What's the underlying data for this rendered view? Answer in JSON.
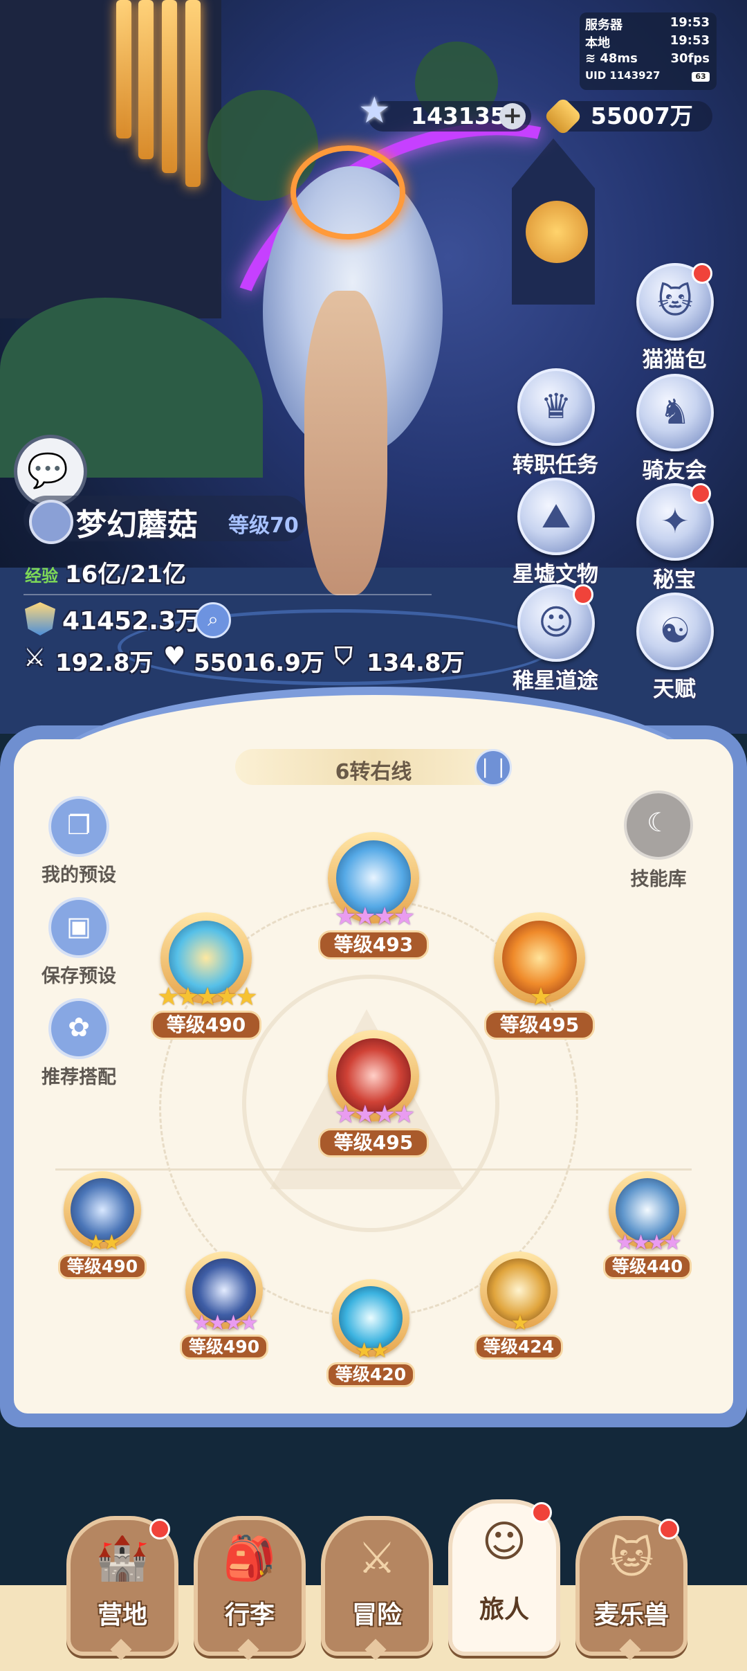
{
  "status": {
    "server_label": "服务器",
    "server_time": "19:53",
    "local_label": "本地",
    "local_time": "19:53",
    "ping": "48ms",
    "fps": "30fps",
    "uid": "UID 1143927",
    "battery": "63"
  },
  "currency": {
    "stars": "143135",
    "plus": "+",
    "coins": "55007万"
  },
  "right_menu": [
    {
      "label": "猫猫包",
      "icon": "cat-bag-icon",
      "badge": true
    },
    {
      "label": "转职任务",
      "icon": "job-change-icon",
      "badge": false
    },
    {
      "label": "骑友会",
      "icon": "horse-icon",
      "badge": false
    },
    {
      "label": "星墟文物",
      "icon": "relic-icon",
      "badge": false
    },
    {
      "label": "秘宝",
      "icon": "treasure-icon",
      "badge": true
    },
    {
      "label": "稚星道途",
      "icon": "star-path-icon",
      "badge": true
    },
    {
      "label": "天赋",
      "icon": "talent-icon",
      "badge": false
    }
  ],
  "player": {
    "name": "梦幻蘑菇",
    "level": "等级70",
    "exp_label": "经验",
    "exp": "16亿/21亿",
    "power": "41452.3万",
    "attack": "192.8万",
    "hp": "55016.9万",
    "defense": "134.8万"
  },
  "panel": {
    "title": "6转右线",
    "side_buttons": [
      "我的预设",
      "保存预设",
      "推荐搭配"
    ],
    "skill_library": "技能库",
    "skills": [
      {
        "level": "等级493",
        "stars": 4,
        "star_color": "pink"
      },
      {
        "level": "等级490",
        "stars": 5,
        "star_color": "gold"
      },
      {
        "level": "等级495",
        "stars": 1,
        "star_color": "gold"
      },
      {
        "level": "等级495",
        "stars": 4,
        "star_color": "pink"
      },
      {
        "level": "等级490",
        "stars": 2,
        "star_color": "gold"
      },
      {
        "level": "等级490",
        "stars": 4,
        "star_color": "pink"
      },
      {
        "level": "等级420",
        "stars": 2,
        "star_color": "gold"
      },
      {
        "level": "等级424",
        "stars": 1,
        "star_color": "gold"
      },
      {
        "level": "等级440",
        "stars": 4,
        "star_color": "pink"
      }
    ]
  },
  "bottom_nav": [
    {
      "label": "营地",
      "badge": true,
      "active": false
    },
    {
      "label": "行李",
      "badge": false,
      "active": false
    },
    {
      "label": "冒险",
      "badge": false,
      "active": false
    },
    {
      "label": "旅人",
      "badge": true,
      "active": true
    },
    {
      "label": "麦乐兽",
      "badge": true,
      "active": false
    }
  ],
  "colors": {
    "panel_bg": "#fbf5e8",
    "panel_border": "#6f8fd0",
    "level_badge": "#a95a2b",
    "badge_red": "#f0433a",
    "star_gold": "#f6c232",
    "star_pink": "#e99cf0"
  }
}
